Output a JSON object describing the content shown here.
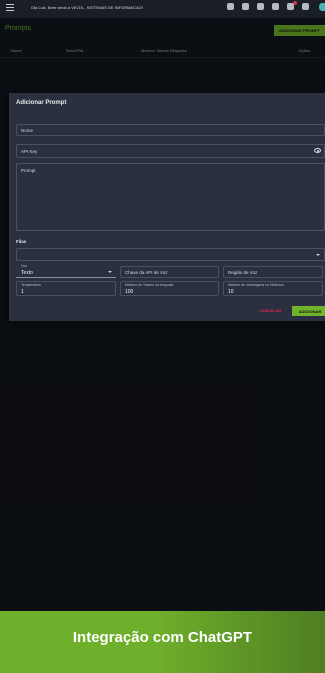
{
  "header": {
    "greeting": "Olá Luiz, Bem vindo a VELTA - SISTEMAS DE INFORMACAO!",
    "icons": [
      "menu-icon",
      "settings-icon",
      "volume-icon",
      "refresh-icon",
      "chat-icon",
      "notification-bell-icon",
      "messages-icon",
      "avatar"
    ]
  },
  "page": {
    "title": "Prompts",
    "add_button": "ADICIONAR PROMPT",
    "columns": [
      "Nome",
      "Setor/Fila",
      "Máximo Tokens Resposta",
      "Ações"
    ]
  },
  "dialog": {
    "title": "Adicionar Prompt",
    "fields": {
      "name": "Nome",
      "api_key": "API Key",
      "prompt": "Prompt",
      "queues": "Filas"
    },
    "voice": {
      "label": "Voz",
      "value": "Texto"
    },
    "voice_api_key": "Chave da API de Voz",
    "voice_region": "Região de Voz",
    "temperature": {
      "label": "Temperatura",
      "value": "1"
    },
    "max_tokens": {
      "label": "Máximo de Tokens na resposta",
      "value": "100"
    },
    "max_messages": {
      "label": "Máximo de mensagens no Histórico",
      "value": "10"
    },
    "cancel": "CANCELAR",
    "submit": "ADICIONAR"
  },
  "banner": {
    "text": "Integração com ChatGPT"
  },
  "colors": {
    "accent": "#6fb42c",
    "cancel": "#e0284c",
    "dialog_bg": "#2b3040",
    "page_bg": "#12161d"
  }
}
